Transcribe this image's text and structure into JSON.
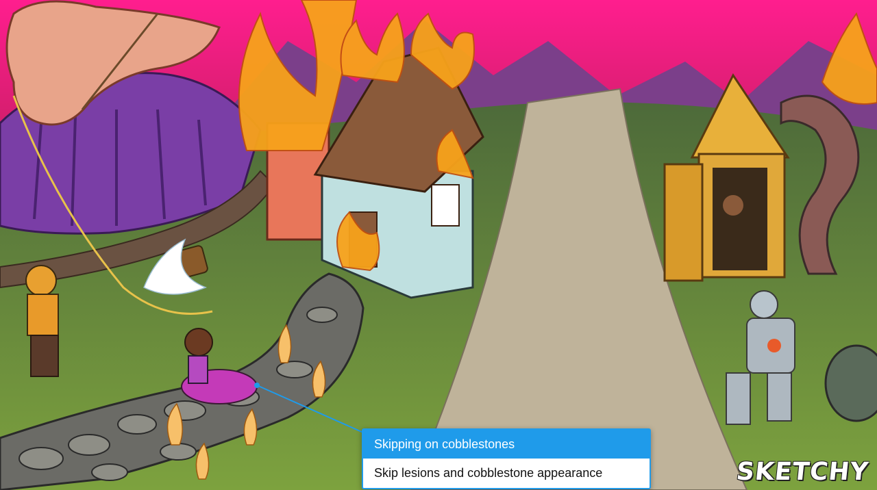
{
  "callout": {
    "title": "Skipping on cobblestones",
    "description": "Skip lesions and cobblestone appearance"
  },
  "branding": {
    "logo_text": "SKETCHY"
  },
  "colors": {
    "accent": "#1f9bea",
    "sky": "#e8237a",
    "fire": "#f7a21b"
  }
}
